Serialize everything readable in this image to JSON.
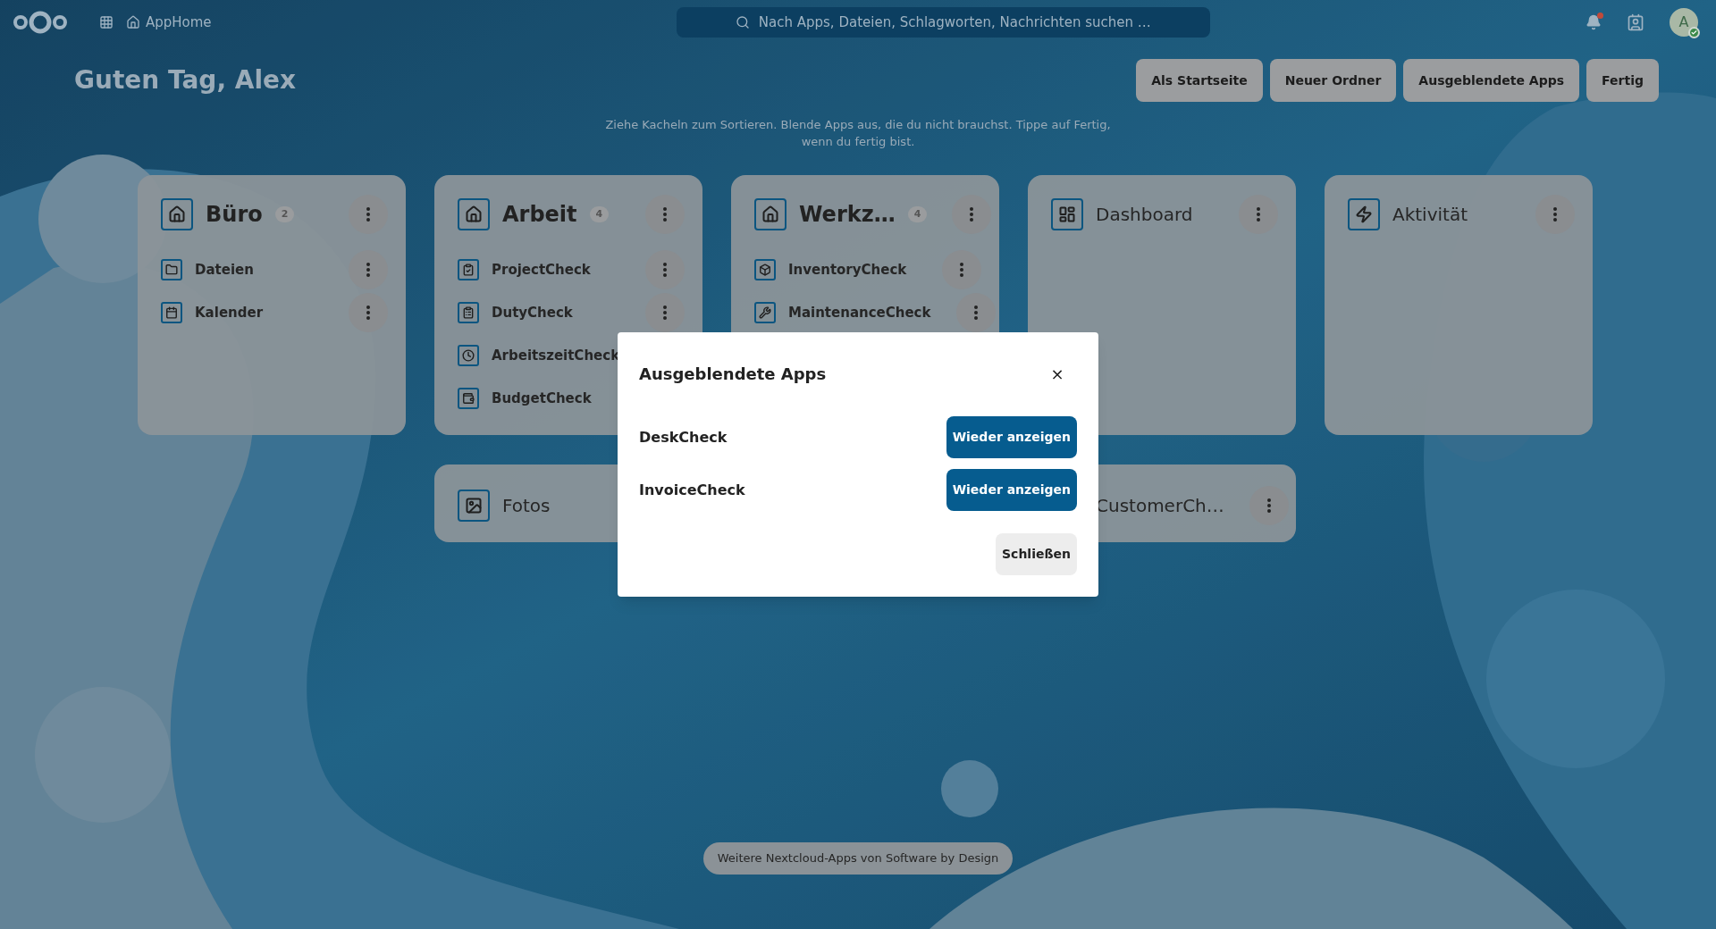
{
  "topbar": {
    "app_name": "AppHome",
    "search": {
      "placeholder": "Nach Apps, Dateien, Schlagworten, Nachrichten suchen …"
    },
    "avatar": {
      "initial": "A"
    }
  },
  "header": {
    "greeting": "Guten Tag, Alex",
    "buttons": [
      "Als Startseite",
      "Neuer Ordner",
      "Ausgeblendete Apps",
      "Fertig"
    ]
  },
  "hint": "Ziehe Kacheln zum Sortieren. Blende Apps aus, die du nicht brauchst. Tippe auf Fertig, wenn du fertig bist.",
  "tiles": [
    {
      "kind": "folder",
      "title": "Büro",
      "count": "2",
      "apps": [
        {
          "name": "Dateien"
        },
        {
          "name": "Kalender"
        }
      ]
    },
    {
      "kind": "folder",
      "title": "Arbeit",
      "count": "4",
      "apps": [
        {
          "name": "ProjectCheck"
        },
        {
          "name": "DutyCheck"
        },
        {
          "name": "ArbeitszeitCheck"
        },
        {
          "name": "BudgetCheck"
        }
      ]
    },
    {
      "kind": "folder",
      "title": "Werkz…",
      "count": "4",
      "apps": [
        {
          "name": "InventoryCheck"
        },
        {
          "name": "MaintenanceCheck"
        }
      ]
    },
    {
      "kind": "app",
      "title": "Dashboard"
    },
    {
      "kind": "app",
      "title": "Aktivität"
    },
    {
      "kind": "small",
      "title": "Fotos"
    },
    {
      "kind": "small",
      "title": "CustomerCh…"
    }
  ],
  "dialog": {
    "title": "Ausgeblendete Apps",
    "close": "×",
    "apps": [
      {
        "name": "DeskCheck",
        "action": "Wieder anzeigen"
      },
      {
        "name": "InvoiceCheck",
        "action": "Wieder anzeigen"
      }
    ],
    "footer_button": "Schließen"
  },
  "footer": {
    "link": "Weitere Nextcloud-Apps von Software by Design"
  }
}
